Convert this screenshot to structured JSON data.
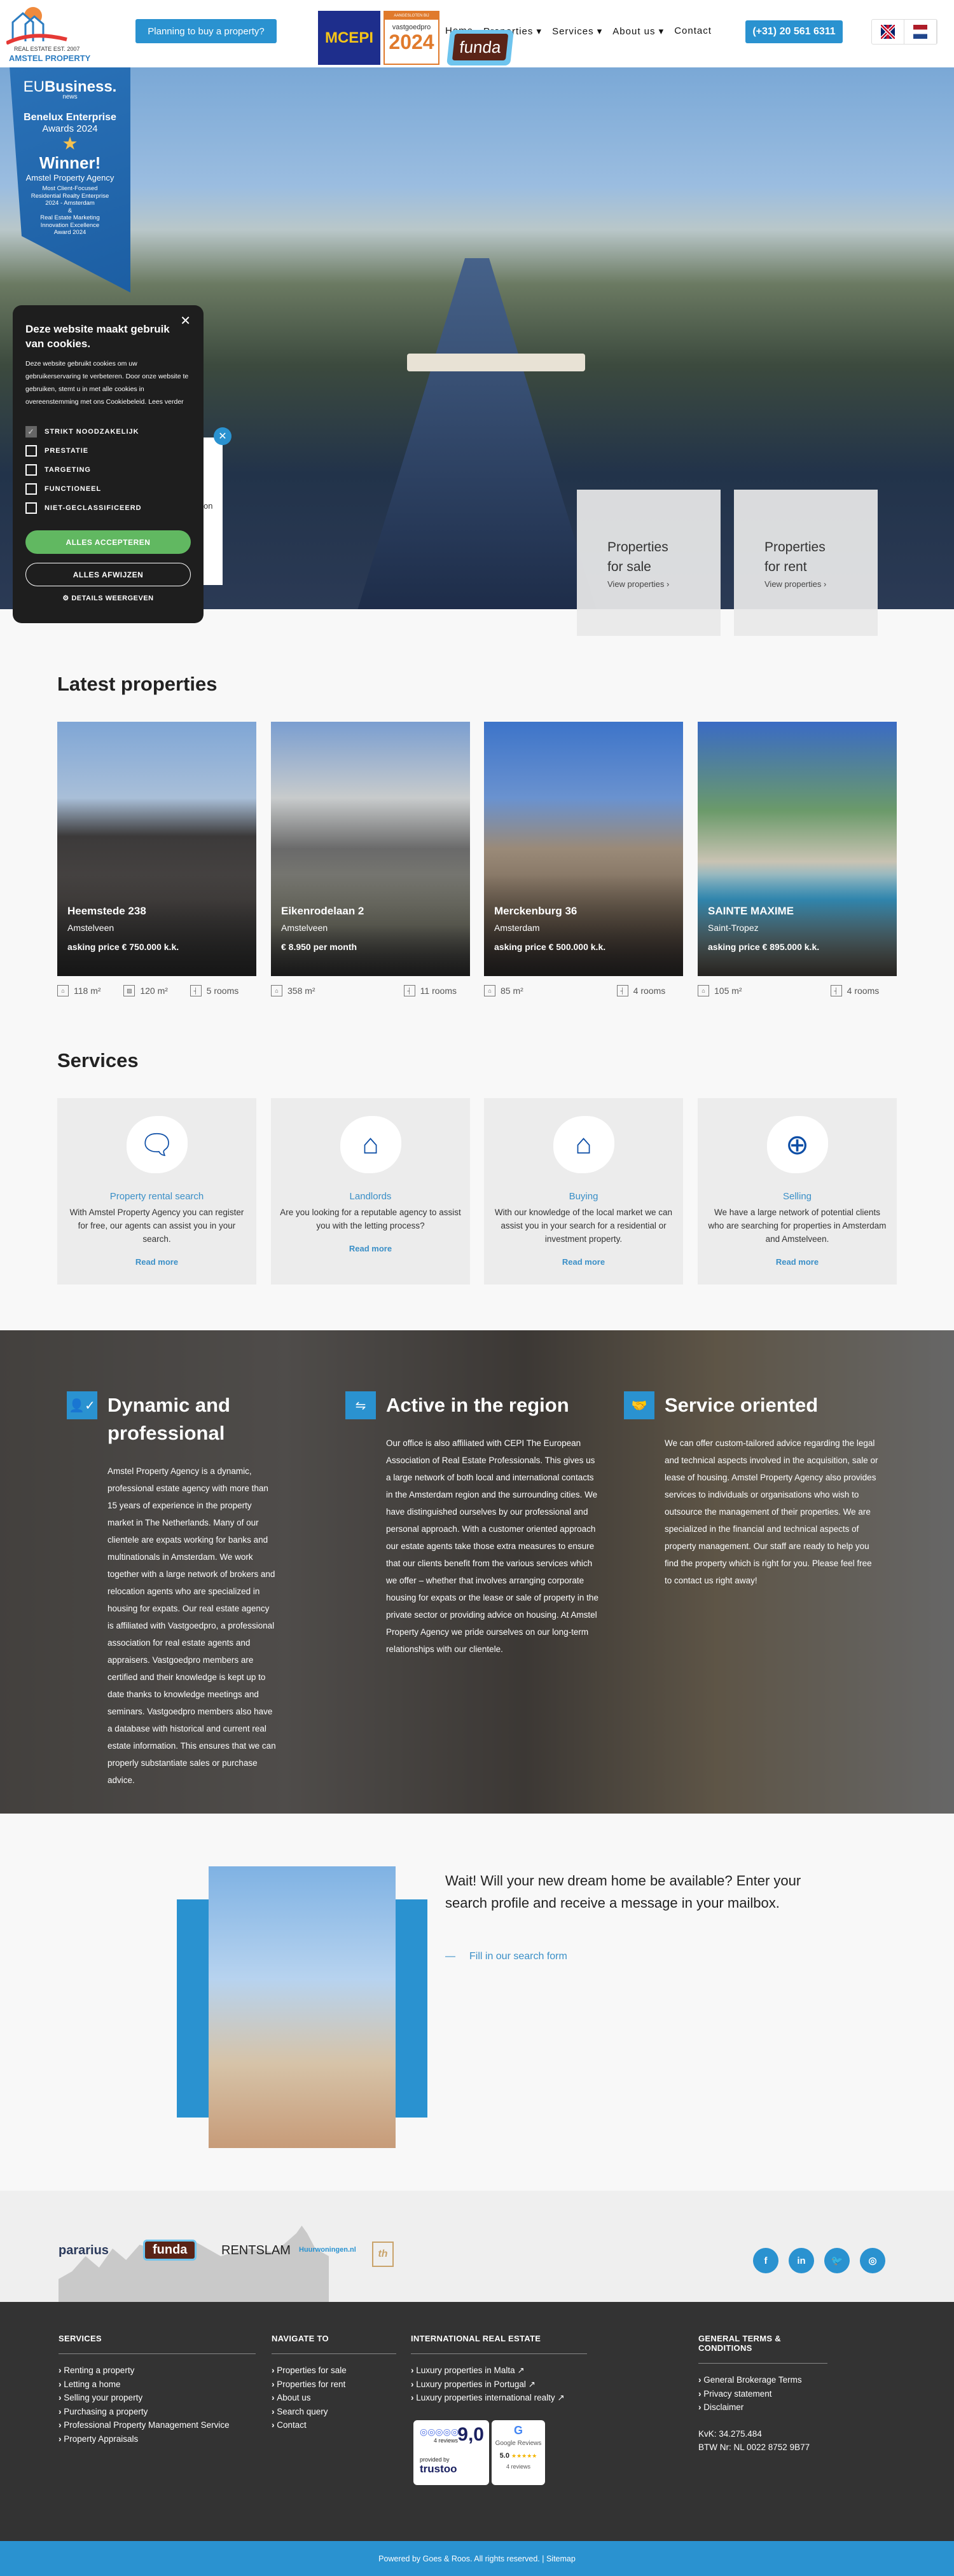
{
  "header": {
    "logo_line1": "REAL ESTATE EST. 2007",
    "logo_line2": "AMSTEL PROPERTY",
    "plan_button": "Planning to buy a property?",
    "badges": {
      "mcepi": "MCEPI",
      "vastgoedpro_top": "AANGESLOTEN BIJ",
      "vastgoedpro_name": "vastgoedpro",
      "vastgoedpro_year": "2024",
      "funda": "funda"
    },
    "nav": [
      "Home",
      "Properties ▾",
      "Services ▾",
      "About us ▾",
      "Contact"
    ],
    "phone": "(+31) 20 561 6311",
    "languages": [
      "en",
      "nl"
    ]
  },
  "award": {
    "brand": "EU",
    "brand_bold": "Business.",
    "brand_sub": "news",
    "title1": "Benelux Enterprise",
    "title2": "Awards 2024",
    "winner": "Winner!",
    "company": "Amstel Property Agency",
    "desc": [
      "Most Client-Focused",
      "Residential Realty Enterprise",
      "2024 - Amsterdam",
      "&",
      "Real Estate Marketing",
      "Innovation Excellence",
      "Award 2024"
    ]
  },
  "hidden_fragment": "on",
  "cookie": {
    "title": "Deze website maakt gebruik van cookies.",
    "text": "Deze website gebruikt cookies om uw gebruikerservaring te verbeteren. Door onze website te gebruiken, stemt u in met alle cookies in overeenstemming met ons Cookiebeleid.",
    "read_more": "Lees verder",
    "options": [
      {
        "label": "STRIKT NOODZAKELIJK",
        "checked": true
      },
      {
        "label": "PRESTATIE",
        "checked": false
      },
      {
        "label": "TARGETING",
        "checked": false
      },
      {
        "label": "FUNCTIONEEL",
        "checked": false
      },
      {
        "label": "NIET-GECLASSIFICEERD",
        "checked": false
      }
    ],
    "accept": "ALLES ACCEPTEREN",
    "reject": "ALLES AFWIJZEN",
    "details": "DETAILS WEERGEVEN"
  },
  "hero_boxes": [
    {
      "line1": "Properties",
      "line2": "for sale",
      "link": "View properties"
    },
    {
      "line1": "Properties",
      "line2": "for rent",
      "link": "View properties"
    }
  ],
  "latest": {
    "title": "Latest properties",
    "items": [
      {
        "name": "Heemstede 238",
        "city": "Amstelveen",
        "price": "asking price € 750.000 k.k.",
        "specs": [
          "118 m²",
          "120 m²",
          "5 rooms"
        ]
      },
      {
        "name": "Eikenrodelaan 2",
        "city": "Amstelveen",
        "price": "€ 8.950 per month",
        "specs": [
          "358 m²",
          "",
          "11 rooms"
        ]
      },
      {
        "name": "Merckenburg 36",
        "city": "Amsterdam",
        "price": "asking price € 500.000 k.k.",
        "specs": [
          "85 m²",
          "",
          "4 rooms"
        ]
      },
      {
        "name": "SAINTE MAXIME",
        "city": "Saint-Tropez",
        "price": "asking price € 895.000 k.k.",
        "specs": [
          "105 m²",
          "",
          "4 rooms"
        ]
      }
    ]
  },
  "services": {
    "title": "Services",
    "items": [
      {
        "title": "Property rental search",
        "text": "With Amstel Property Agency you can register for free, our agents can assist you in your search.",
        "link": "Read more",
        "icon": "house-chat-icon"
      },
      {
        "title": "Landlords",
        "text": "Are you looking for a reputable agency to assist you with the letting process?",
        "link": "Read more",
        "icon": "house-pin-icon"
      },
      {
        "title": "Buying",
        "text": "With our knowledge of the local market we can assist you in your search for a residential or investment property.",
        "link": "Read more",
        "icon": "house-chart-icon"
      },
      {
        "title": "Selling",
        "text": "We have a large network of potential clients who are searching for properties in Amsterdam and Amstelveen.",
        "link": "Read more",
        "icon": "house-plus-icon"
      }
    ]
  },
  "about": [
    {
      "title": "Dynamic and professional",
      "icon": "user-check-icon",
      "text": "Amstel Property Agency is a dynamic, professional estate agency with more than 15 years of experience in the property market in The Netherlands. Many of our clientele are expats working for banks and multinationals in Amsterdam. We work together with a large network of brokers and relocation agents who are specialized in housing for expats. Our real estate agency is affiliated with Vastgoedpro, a professional association for real estate agents and appraisers. Vastgoedpro members are certified and their knowledge is kept up to date thanks to knowledge meetings and seminars. Vastgoedpro members also have a database with historical and current real estate information. This ensures that we can properly substantiate sales or purchase advice."
    },
    {
      "title": "Active in the region",
      "icon": "signpost-icon",
      "text": "Our office is also affiliated with CEPI The European Association of Real Estate Professionals. This gives us a large network of both local and international contacts in the Amsterdam region and the surrounding cities. We have distinguished ourselves by our professional and personal approach. With a customer oriented approach our estate agents take those extra measures to ensure that our clients benefit from the various services which we offer – whether that involves arranging corporate housing for expats or the lease or sale of property in the private sector or providing advice on housing. At Amstel Property Agency we pride ourselves on our long-term relationships with our clientele."
    },
    {
      "title": "Service oriented",
      "icon": "handshake-icon",
      "text": "We can offer custom-tailored advice regarding the legal and technical aspects involved in the acquisition, sale or lease of housing. Amstel Property Agency also provides services to individuals or organisations who wish to outsource the management of their properties. We are specialized in the financial and technical aspects of property management. Our staff are ready to help you find the property which is right for you. Please feel free to contact us right away!"
    }
  ],
  "search_cta": {
    "text": "Wait! Will your new dream home be available? Enter your search profile and receive a message in your mailbox.",
    "link": "Fill in our search form"
  },
  "partners": [
    "pararius",
    "funda",
    "RENTSLAM",
    "Huurwoningen.nl",
    "th"
  ],
  "social": [
    "facebook",
    "linkedin",
    "twitter",
    "instagram"
  ],
  "footer": {
    "services": {
      "title": "SERVICES",
      "items": [
        "Renting a property",
        "Letting a home",
        "Selling your property",
        "Purchasing a property",
        "Professional Property Management Service",
        "Property Appraisals"
      ]
    },
    "navigate": {
      "title": "NAVIGATE TO",
      "items": [
        "Properties for sale",
        "Properties for rent",
        "About us",
        "Search query",
        "Contact"
      ]
    },
    "international": {
      "title": "INTERNATIONAL REAL ESTATE",
      "items": [
        "Luxury properties in Malta",
        "Luxury properties in Portugal",
        "Luxury properties international realty"
      ]
    },
    "terms": {
      "title": "GENERAL TERMS & CONDITIONS",
      "items": [
        "General Brokerage Terms",
        "Privacy statement",
        "Disclaimer"
      ],
      "kvk": "KvK: 34.275.484",
      "btw": "BTW Nr: NL 0022 8752 9B77"
    },
    "trustoo": {
      "score": "9,0",
      "reviews": "4 reviews",
      "provided": "provided by",
      "brand": "trustoo"
    },
    "google": {
      "label": "Google Reviews",
      "score": "5.0",
      "stars": "★★★★★",
      "reviews": "4 reviews"
    },
    "copyright": "Powered by Goes & Roos. All rights reserved. | Sitemap"
  },
  "colors": {
    "accent": "#2a92d0",
    "footer": "#333333",
    "accept": "#61b861"
  }
}
